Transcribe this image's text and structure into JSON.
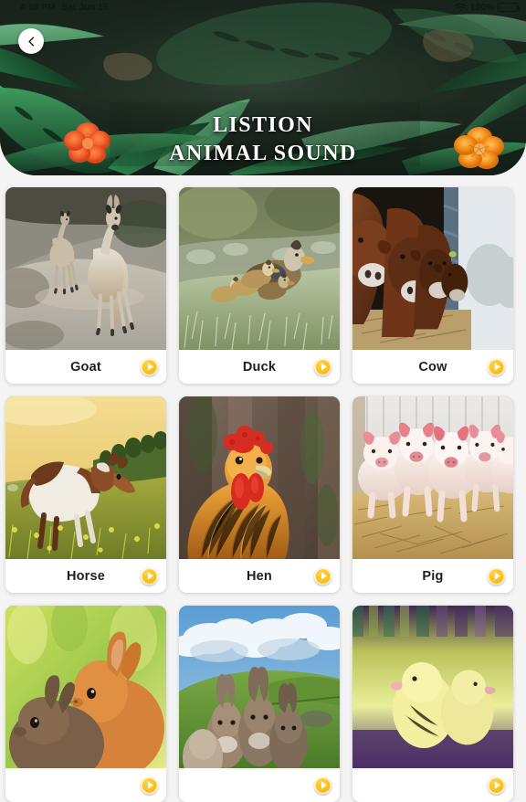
{
  "status_bar": {
    "time": "4:08 PM",
    "date": "Sat Jun 15",
    "battery_percent": "100%",
    "location_icon": "location-arrow-icon",
    "signal_icon": "signal-bars-icon",
    "wifi_icon": "wifi-icon",
    "battery_icon": "battery-full-icon"
  },
  "header": {
    "back_icon": "chevron-left-icon",
    "title_line1": "LISTION",
    "title_line2": "ANIMAL SOUND",
    "background_theme": "tropical-jungle-leaves",
    "colors": {
      "background_dark": "#18241d",
      "leaf_green": "#2f7d4f",
      "leaf_light": "#6fc08a",
      "flower_orange": "#f4622d",
      "flower_orange_2": "#f39220"
    }
  },
  "theme": {
    "page_background": "#f4f4f4",
    "card_background": "#ffffff",
    "label_color": "#1e1e1e",
    "play_button_color": "#ffc21c"
  },
  "grid": {
    "play_icon": "play-triangle-icon",
    "cards": [
      {
        "label": "Goat",
        "image": "goat-and-kid-on-rocky-hillside"
      },
      {
        "label": "Duck",
        "image": "mallard-duck-with-ducklings-in-frosty-grass"
      },
      {
        "label": "Cow",
        "image": "brown-cows-lined-up-at-barn-feeder"
      },
      {
        "label": "Horse",
        "image": "brown-and-white-horse-in-golden-rapeseed-field"
      },
      {
        "label": "Hen",
        "image": "orange-rooster-with-red-comb-closeup"
      },
      {
        "label": "Pig",
        "image": "piglets-on-straw-in-barn"
      },
      {
        "label": "",
        "image": "rabbits-in-green-grass"
      },
      {
        "label": "",
        "image": "donkeys-on-green-hill-under-cloudy-sky"
      },
      {
        "label": "",
        "image": "yellow-bird-on-purple-background"
      }
    ]
  }
}
